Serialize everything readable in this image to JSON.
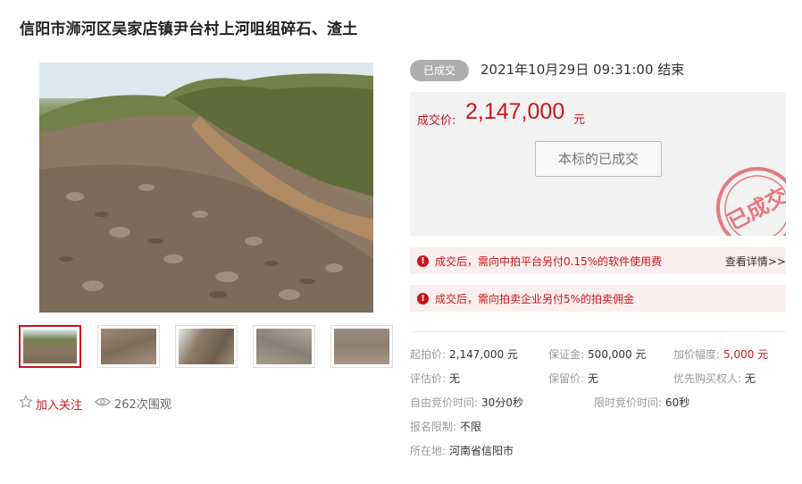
{
  "title": "信阳市浉河区吴家店镇尹台村上河咀组碎石、渣土",
  "status": {
    "badge": "已成交",
    "end_time": "2021年10月29日  09:31:00 结束"
  },
  "price": {
    "label": "成交价:",
    "value": "2,147,000",
    "unit": "元",
    "button": "本标的已成交",
    "stamp": "已成交"
  },
  "notices": [
    {
      "text": "成交后，需向中拍平台另付0.15%的软件使用费",
      "link": "查看详情>>"
    },
    {
      "text": "成交后，需向拍卖企业另付5%的拍卖佣金"
    }
  ],
  "follow": {
    "label": "加入关注"
  },
  "views": {
    "label": "262次围观"
  },
  "details": {
    "start_price": {
      "label": "起拍价:",
      "value": "2,147,000 元"
    },
    "deposit": {
      "label": "保证金:",
      "value": "500,000 元"
    },
    "increment": {
      "label": "加价幅度:",
      "value": "5,000 元"
    },
    "appraisal": {
      "label": "评估价:",
      "value": "无"
    },
    "reserve": {
      "label": "保留价:",
      "value": "无"
    },
    "priority": {
      "label": "优先购买权人:",
      "value": "无"
    },
    "free_bid_time": {
      "label": "自由竞价时间:",
      "value": "30分0秒"
    },
    "timed_bid_time": {
      "label": "限时竞价时间:",
      "value": "60秒"
    },
    "restriction": {
      "label": "报名限制:",
      "value": "不限"
    },
    "location": {
      "label": "所在地:",
      "value": "河南省信阳市"
    }
  },
  "colors": {
    "accent": "#c8161d",
    "badge_gray": "#aeaeae",
    "panel_bg": "#f2f2f2",
    "notice_bg": "#fbeeee"
  }
}
